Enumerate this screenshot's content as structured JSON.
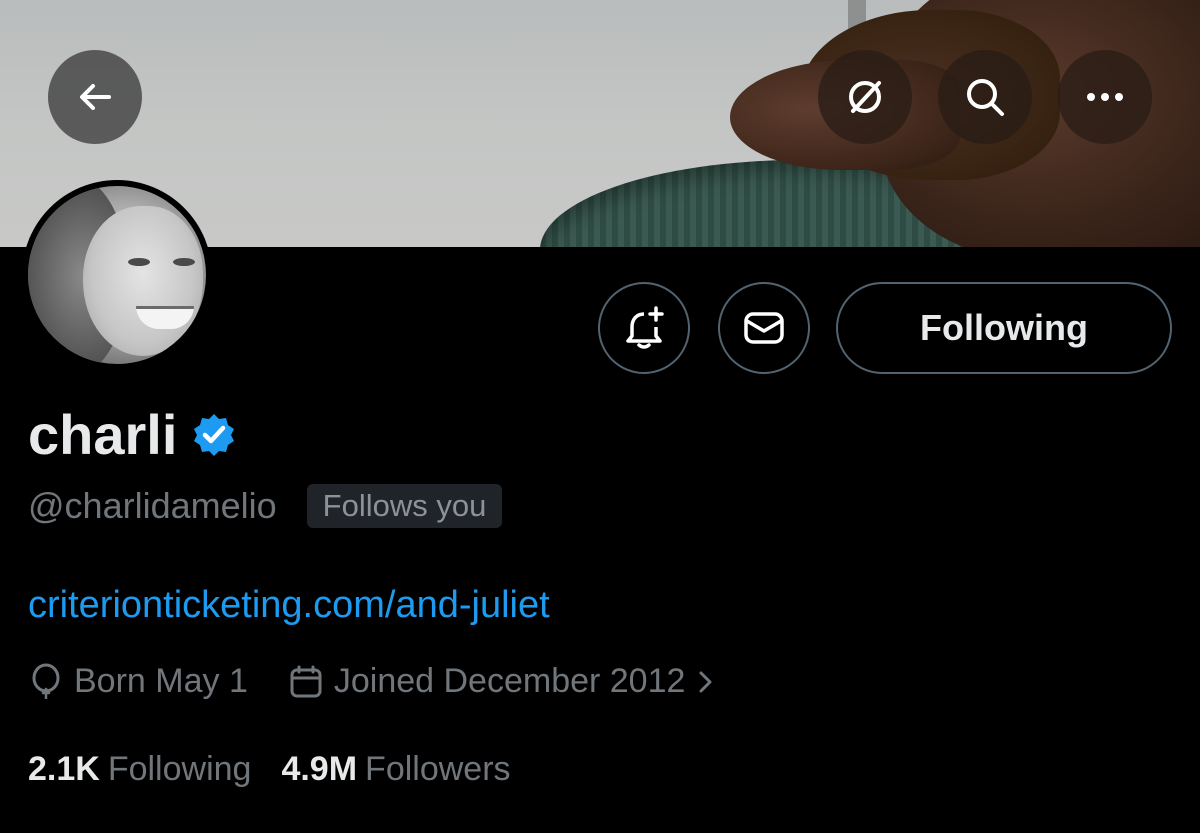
{
  "header": {
    "back_icon": "arrow-left-icon",
    "actions": [
      {
        "icon": "unfollow-hide-icon"
      },
      {
        "icon": "search-icon"
      },
      {
        "icon": "more-icon"
      }
    ]
  },
  "profile": {
    "display_name": "charli",
    "verified_icon": "verified-badge-icon",
    "verified_color": "#1d9bf0",
    "handle": "@charlidamelio",
    "follows_you": "Follows you",
    "website": "criterionticketing.com/and-juliet",
    "born": "Born May 1",
    "joined": "Joined December 2012"
  },
  "actions": {
    "notify_icon": "bell-plus-icon",
    "message_icon": "envelope-icon",
    "following_label": "Following"
  },
  "stats": {
    "following_count": "2.1K",
    "following_label": "Following",
    "followers_count": "4.9M",
    "followers_label": "Followers"
  },
  "colors": {
    "background": "#000000",
    "link": "#1d9bf0",
    "muted": "#71767b"
  }
}
